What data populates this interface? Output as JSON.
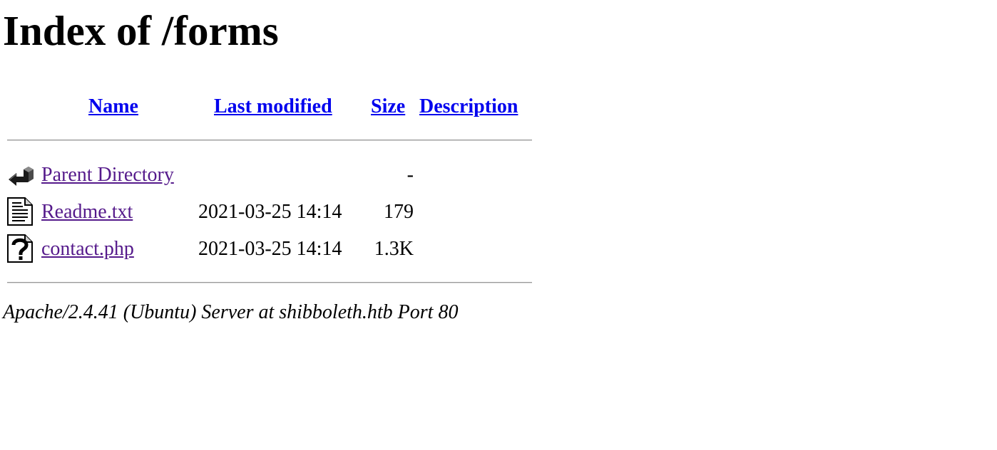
{
  "page": {
    "title": "Index of /forms"
  },
  "table": {
    "headers": {
      "name": "Name",
      "last_modified": "Last modified",
      "size": "Size",
      "description": "Description"
    },
    "rows": [
      {
        "icon": "back-arrow-icon",
        "name": "Parent Directory",
        "last_modified": "",
        "size": "-",
        "description": ""
      },
      {
        "icon": "text-file-icon",
        "name": "Readme.txt",
        "last_modified": "2021-03-25 14:14",
        "size": "179",
        "description": ""
      },
      {
        "icon": "unknown-file-icon",
        "name": "contact.php",
        "last_modified": "2021-03-25 14:14",
        "size": "1.3K",
        "description": ""
      }
    ]
  },
  "footer": {
    "signature": "Apache/2.4.41 (Ubuntu) Server at shibboleth.htb Port 80"
  },
  "colors": {
    "link": "#0000ee",
    "visited_link": "#551a8b",
    "text": "#000000",
    "background": "#ffffff"
  }
}
